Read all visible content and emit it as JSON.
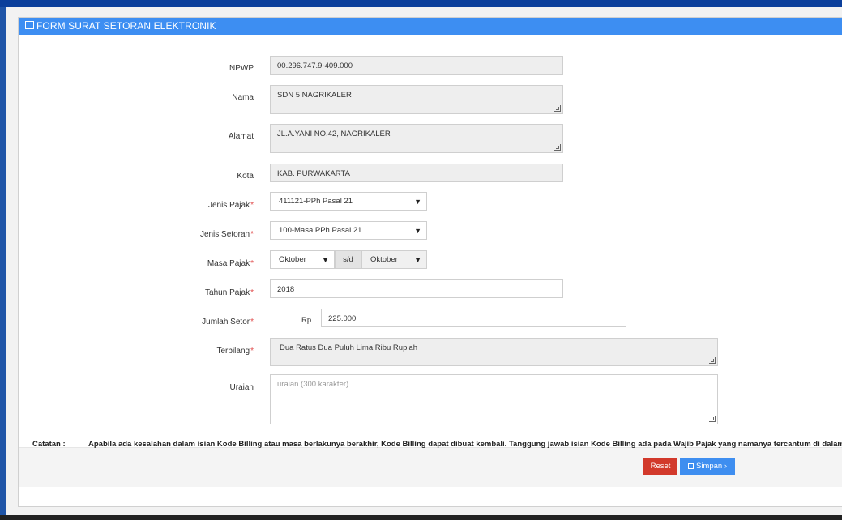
{
  "header": {
    "title": "FORM SURAT SETORAN ELEKTRONIK",
    "icon": "edit-icon"
  },
  "form": {
    "npwp": {
      "label": "NPWP",
      "value": "00.296.747.9-409.000"
    },
    "nama": {
      "label": "Nama",
      "value": "SDN 5 NAGRIKALER"
    },
    "alamat": {
      "label": "Alamat",
      "value": "JL.A.YANI NO.42, NAGRIKALER"
    },
    "kota": {
      "label": "Kota",
      "value": "KAB. PURWAKARTA"
    },
    "jenis_pajak": {
      "label": "Jenis Pajak",
      "value": "411121-PPh Pasal 21"
    },
    "jenis_setoran": {
      "label": "Jenis Setoran",
      "value": "100-Masa PPh Pasal 21"
    },
    "masa_pajak": {
      "label": "Masa Pajak",
      "from": "Oktober",
      "sep": "s/d",
      "to": "Oktober"
    },
    "tahun_pajak": {
      "label": "Tahun Pajak",
      "value": "2018"
    },
    "jumlah_setor": {
      "label": "Jumlah Setor",
      "prefix": "Rp.",
      "value": "225.000"
    },
    "terbilang": {
      "label": "Terbilang",
      "value": "Dua Ratus Dua Puluh Lima Ribu  Rupiah"
    },
    "uraian": {
      "label": "Uraian",
      "placeholder": "uraian (300 karakter)"
    },
    "required_mark": "*"
  },
  "note": {
    "label": "Catatan :",
    "text": "Apabila ada kesalahan dalam isian Kode Billing atau masa berlakunya berakhir, Kode Billing dapat dibuat kembali. Tanggung jawab isian Kode Billing ada pada Wajib Pajak yang namanya tercantum di dalamnya."
  },
  "buttons": {
    "reset": "Reset",
    "save": "Simpan ›"
  },
  "colors": {
    "header": "#3d8ef2",
    "reset": "#d2392b",
    "save": "#3e8ef0",
    "required": "#e04b4b"
  }
}
